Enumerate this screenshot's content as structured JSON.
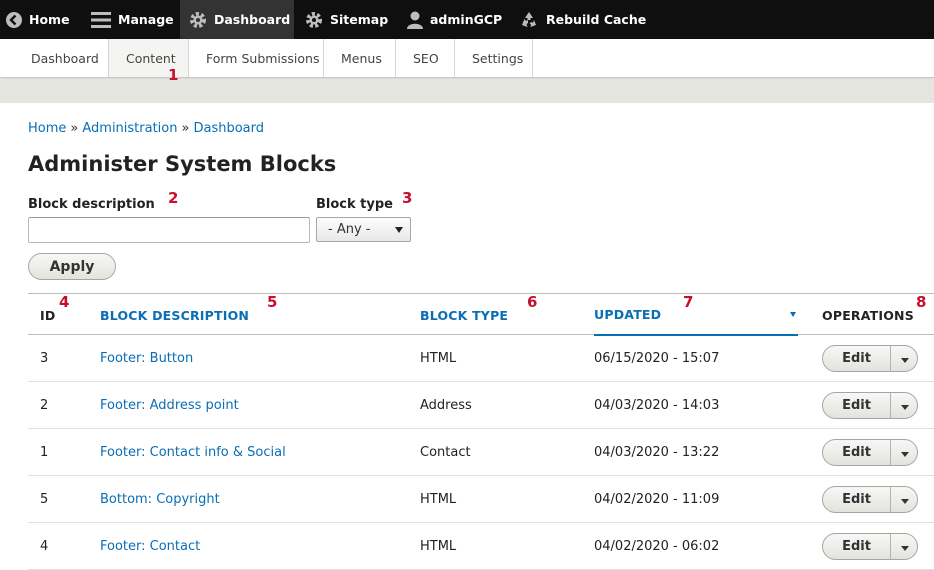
{
  "toolbar": {
    "home": "Home",
    "manage": "Manage",
    "dashboard": "Dashboard",
    "sitemap": "Sitemap",
    "user": "adminGCP",
    "rebuild": "Rebuild Cache"
  },
  "tray": {
    "dashboard": "Dashboard",
    "content": "Content",
    "form_submissions": "Form Submissions",
    "menus": "Menus",
    "seo": "SEO",
    "settings": "Settings"
  },
  "annotations": {
    "n1": "1",
    "n2": "2",
    "n3": "3",
    "n4": "4",
    "n5": "5",
    "n6": "6",
    "n7": "7",
    "n8": "8"
  },
  "breadcrumb": {
    "home": "Home",
    "sep1": "»",
    "administration": "Administration",
    "sep2": "»",
    "dashboard": "Dashboard"
  },
  "page_title": "Administer System Blocks",
  "filters": {
    "description_label": "Block description",
    "description_value": "",
    "type_label": "Block type",
    "type_value": "- Any -",
    "apply_label": "Apply"
  },
  "table": {
    "headers": {
      "id": "ID",
      "description": "BLOCK DESCRIPTION",
      "type": "BLOCK TYPE",
      "updated": "UPDATED",
      "operations": "OPERATIONS"
    },
    "rows": [
      {
        "id": "3",
        "description": "Footer: Button",
        "type": "HTML",
        "updated": "06/15/2020 - 15:07",
        "op": "Edit"
      },
      {
        "id": "2",
        "description": "Footer: Address point",
        "type": "Address",
        "updated": "04/03/2020 - 14:03",
        "op": "Edit"
      },
      {
        "id": "1",
        "description": "Footer: Contact info & Social",
        "type": "Contact",
        "updated": "04/03/2020 - 13:22",
        "op": "Edit"
      },
      {
        "id": "5",
        "description": "Bottom: Copyright",
        "type": "HTML",
        "updated": "04/02/2020 - 11:09",
        "op": "Edit"
      },
      {
        "id": "4",
        "description": "Footer: Contact",
        "type": "HTML",
        "updated": "04/02/2020 - 06:02",
        "op": "Edit"
      }
    ]
  },
  "colors": {
    "link": "#0a6eb4",
    "annotation": "#c8102e",
    "toolbar": "#0f0f0f"
  }
}
